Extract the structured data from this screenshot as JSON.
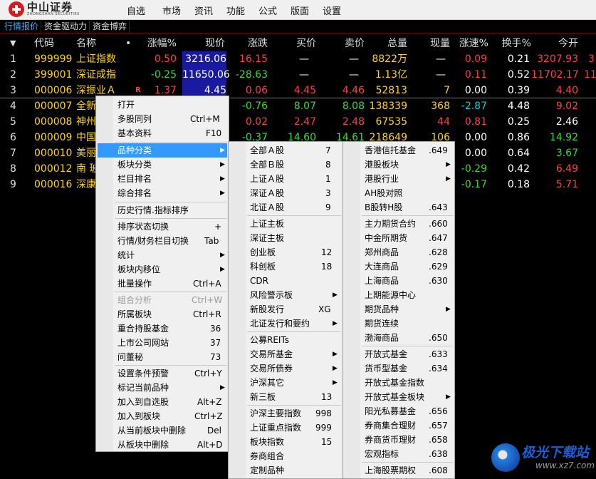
{
  "app": {
    "brand": "中山证券",
    "brand_sub": "ZHONGSHAN SECURITIES",
    "menu": [
      "自选",
      "市场",
      "资讯",
      "功能",
      "公式",
      "版面",
      "设置"
    ]
  },
  "tabs": [
    "行情报价",
    "资金驱动力",
    "资金博弈"
  ],
  "table": {
    "headers": [
      "代码",
      "名称",
      "涨幅%",
      "现价",
      "涨跌",
      "买价",
      "卖价",
      "总量",
      "现量",
      "涨速%",
      "换手%",
      "今开"
    ],
    "dot": "•",
    "sort_arrow": "▼",
    "rows": [
      {
        "idx": "1",
        "code": "999999",
        "name": "上证指数",
        "pct": "0.50",
        "price": "3216.06",
        "chg": "16.15",
        "bid": "—",
        "ask": "—",
        "vol": "8822万",
        "cur": "—",
        "speed": "0.09",
        "turn": "0.21",
        "open": "3207.93",
        "extra": "3"
      },
      {
        "idx": "2",
        "code": "399001",
        "name": "深证成指",
        "pct": "-0.25",
        "price": "11650.06",
        "chg": "-28.63",
        "bid": "—",
        "ask": "—",
        "vol": "1.13亿",
        "cur": "—",
        "speed": "0.11",
        "turn": "0.52",
        "open": "11702.17",
        "extra": "11"
      },
      {
        "idx": "3",
        "code": "000006",
        "name": "深振业Ａ",
        "flag": "R",
        "pct": "1.37",
        "price": "4.45",
        "chg": "0.06",
        "bid": "4.45",
        "ask": "4.46",
        "vol": "52813",
        "cur": "7",
        "speed": "0.00",
        "turn": "0.39",
        "open": "4.40"
      },
      {
        "idx": "4",
        "code": "000007",
        "name": "全新",
        "pct": "",
        "price": "",
        "chg": "-0.76",
        "bid": "8.07",
        "ask": "8.08",
        "vol": "138339",
        "cur": "368",
        "speed": "-2.87",
        "turn": "4.48",
        "open": "9.02"
      },
      {
        "idx": "5",
        "code": "000008",
        "name": "神州",
        "chg": "0.02",
        "bid": "2.47",
        "ask": "2.48",
        "vol": "67535",
        "cur": "44",
        "speed": "0.81",
        "turn": "0.25",
        "open": "2.46"
      },
      {
        "idx": "6",
        "code": "000009",
        "name": "中国",
        "chg": "-0.37",
        "bid": "14.60",
        "ask": "14.61",
        "vol": "218649",
        "cur": "106",
        "speed": "0.00",
        "turn": "0.86",
        "open": "14.92"
      },
      {
        "idx": "7",
        "code": "000010",
        "name": "美丽",
        "speed": "0.00",
        "turn": "0.64",
        "open": "3.67"
      },
      {
        "idx": "8",
        "code": "000012",
        "name": "南 玻",
        "speed": "-0.29",
        "turn": "0.42",
        "open": "6.49"
      },
      {
        "idx": "9",
        "code": "000016",
        "name": "深康",
        "speed": "-0.17",
        "turn": "0.18",
        "open": "5.71"
      }
    ]
  },
  "context_menu": {
    "items": [
      {
        "label": "打开",
        "shortcut": ""
      },
      {
        "label": "多股同列",
        "shortcut": "Ctrl+M"
      },
      {
        "label": "基本资料",
        "shortcut": "F10"
      },
      {
        "label": "品种分类",
        "shortcut": "",
        "submenu": true
      },
      {
        "label": "板块分类",
        "shortcut": "",
        "submenu": true
      },
      {
        "label": "栏目排名",
        "shortcut": "",
        "submenu": true
      },
      {
        "label": "综合排名",
        "shortcut": "",
        "submenu": true
      },
      {
        "label": "历史行情.指标排序",
        "shortcut": ""
      },
      {
        "label": "排序状态切换",
        "shortcut": "+"
      },
      {
        "label": "行情/财务栏目切换",
        "shortcut": "Tab"
      },
      {
        "label": "统计",
        "shortcut": "",
        "submenu": true
      },
      {
        "label": "板块内移位",
        "shortcut": "",
        "submenu": true
      },
      {
        "label": "批量操作",
        "shortcut": "Ctrl+A"
      },
      {
        "label": "组合分析",
        "shortcut": "Ctrl+W"
      },
      {
        "label": "所属板块",
        "shortcut": "Ctrl+R"
      },
      {
        "label": "重合持股基金",
        "shortcut": "36"
      },
      {
        "label": "上市公司网站",
        "shortcut": "37"
      },
      {
        "label": "问董秘",
        "shortcut": "73"
      },
      {
        "label": "设置条件预警",
        "shortcut": "Ctrl+Y"
      },
      {
        "label": "标记当前品种",
        "shortcut": "",
        "submenu": true
      },
      {
        "label": "加入到自选股",
        "shortcut": "Alt+Z"
      },
      {
        "label": "加入到板块",
        "shortcut": "Ctrl+Z"
      },
      {
        "label": "从当前板块中删除",
        "shortcut": "Del"
      },
      {
        "label": "从板块中删除",
        "shortcut": "Alt+D"
      }
    ]
  },
  "submenu1": {
    "items": [
      {
        "label": "全部Ａ股",
        "shortcut": "7"
      },
      {
        "label": "全部Ｂ股",
        "shortcut": "8"
      },
      {
        "label": "上证Ａ股",
        "shortcut": "1"
      },
      {
        "label": "深证Ａ股",
        "shortcut": "3"
      },
      {
        "label": "北证Ａ股",
        "shortcut": "9"
      },
      {
        "label": "上证主板",
        "shortcut": ""
      },
      {
        "label": "深证主板",
        "shortcut": ""
      },
      {
        "label": "创业板",
        "shortcut": "12"
      },
      {
        "label": "科创板",
        "shortcut": "18"
      },
      {
        "label": "CDR",
        "shortcut": ""
      },
      {
        "label": "风险警示板",
        "shortcut": "",
        "submenu": true
      },
      {
        "label": "新股发行",
        "shortcut": "XG"
      },
      {
        "label": "北证发行和要约",
        "shortcut": "",
        "submenu": true
      },
      {
        "label": "公募REITs",
        "shortcut": ""
      },
      {
        "label": "交易所基金",
        "shortcut": "",
        "submenu": true
      },
      {
        "label": "交易所债券",
        "shortcut": "",
        "submenu": true
      },
      {
        "label": "沪深其它",
        "shortcut": "",
        "submenu": true
      },
      {
        "label": "新三板",
        "shortcut": "13"
      },
      {
        "label": "沪深主要指数",
        "shortcut": "998"
      },
      {
        "label": "上证重点指数",
        "shortcut": "999"
      },
      {
        "label": "板块指数",
        "shortcut": "15"
      },
      {
        "label": "券商组合",
        "shortcut": ""
      },
      {
        "label": "定制品种",
        "shortcut": ""
      }
    ]
  },
  "submenu2": {
    "items": [
      {
        "label": "香港信托基金",
        "shortcut": ".649"
      },
      {
        "label": "港股板块",
        "shortcut": "",
        "submenu": true
      },
      {
        "label": "港股行业",
        "shortcut": "",
        "submenu": true
      },
      {
        "label": "AH股对照",
        "shortcut": ""
      },
      {
        "label": "B股转H股",
        "shortcut": ".643"
      },
      {
        "label": "主力期货合约",
        "shortcut": ".660"
      },
      {
        "label": "中金所期货",
        "shortcut": ".647"
      },
      {
        "label": "郑州商品",
        "shortcut": ".628"
      },
      {
        "label": "大连商品",
        "shortcut": ".629"
      },
      {
        "label": "上海商品",
        "shortcut": ".630"
      },
      {
        "label": "上期能源中心",
        "shortcut": ""
      },
      {
        "label": "期货品种",
        "shortcut": "",
        "submenu": true
      },
      {
        "label": "期货连续",
        "shortcut": ""
      },
      {
        "label": "渤海商品",
        "shortcut": ".650"
      },
      {
        "label": "开放式基金",
        "shortcut": ".633"
      },
      {
        "label": "货币型基金",
        "shortcut": ".634"
      },
      {
        "label": "开放式基金指数",
        "shortcut": ""
      },
      {
        "label": "开放式基金板块",
        "shortcut": "",
        "submenu": true
      },
      {
        "label": "阳光私募基金",
        "shortcut": ".656"
      },
      {
        "label": "券商集合理财",
        "shortcut": ".657"
      },
      {
        "label": "券商货币理财",
        "shortcut": ".658"
      },
      {
        "label": "宏观指标",
        "shortcut": ".638"
      },
      {
        "label": "上海股票期权",
        "shortcut": ".608"
      }
    ]
  },
  "watermark": {
    "text": "极光下载站",
    "url": "www.xz7.com"
  }
}
